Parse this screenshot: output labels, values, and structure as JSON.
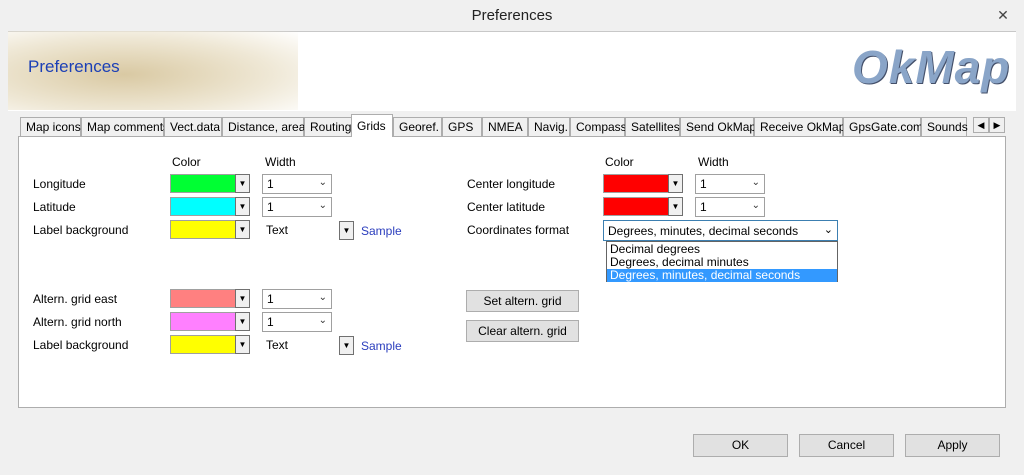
{
  "window": {
    "title": "Preferences",
    "close_icon": "close-icon"
  },
  "banner": {
    "title": "Preferences",
    "logo": "OkMap"
  },
  "tabs": [
    {
      "label": "Map icons"
    },
    {
      "label": "Map comments"
    },
    {
      "label": "Vect.data"
    },
    {
      "label": "Distance, area"
    },
    {
      "label": "Routing"
    },
    {
      "label": "Grids",
      "active": true
    },
    {
      "label": "Georef."
    },
    {
      "label": "GPS"
    },
    {
      "label": "NMEA"
    },
    {
      "label": "Navig."
    },
    {
      "label": "Compass"
    },
    {
      "label": "Satellites"
    },
    {
      "label": "Send OkMap"
    },
    {
      "label": "Receive OkMap"
    },
    {
      "label": "GpsGate.com"
    },
    {
      "label": "Sounds"
    }
  ],
  "grid": {
    "header_color": "Color",
    "header_width": "Width",
    "longitude": {
      "label": "Longitude",
      "color": "#00ff33",
      "width": "1"
    },
    "latitude": {
      "label": "Latitude",
      "color": "#00ffff",
      "width": "1"
    },
    "label_bg": {
      "label": "Label background",
      "color": "#ffff00",
      "text": "Text",
      "sample": "Sample"
    }
  },
  "center": {
    "header_color": "Color",
    "header_width": "Width",
    "longitude": {
      "label": "Center longitude",
      "color": "#ff0000",
      "width": "1"
    },
    "latitude": {
      "label": "Center latitude",
      "color": "#ff0000",
      "width": "1"
    },
    "coords": {
      "label": "Coordinates format",
      "value": "Degrees, minutes, decimal seconds",
      "options": [
        "Decimal degrees",
        "Degrees, decimal minutes",
        "Degrees, minutes, decimal seconds"
      ]
    }
  },
  "altern": {
    "east": {
      "label": "Altern. grid east",
      "color": "#ff8080",
      "width": "1"
    },
    "north": {
      "label": "Altern. grid north",
      "color": "#ff80ff",
      "width": "1"
    },
    "label_bg": {
      "label": "Label background",
      "color": "#ffff00",
      "text": "Text",
      "sample": "Sample"
    },
    "set_button": "Set altern. grid",
    "clear_button": "Clear altern. grid"
  },
  "footer": {
    "ok": "OK",
    "cancel": "Cancel",
    "apply": "Apply"
  }
}
